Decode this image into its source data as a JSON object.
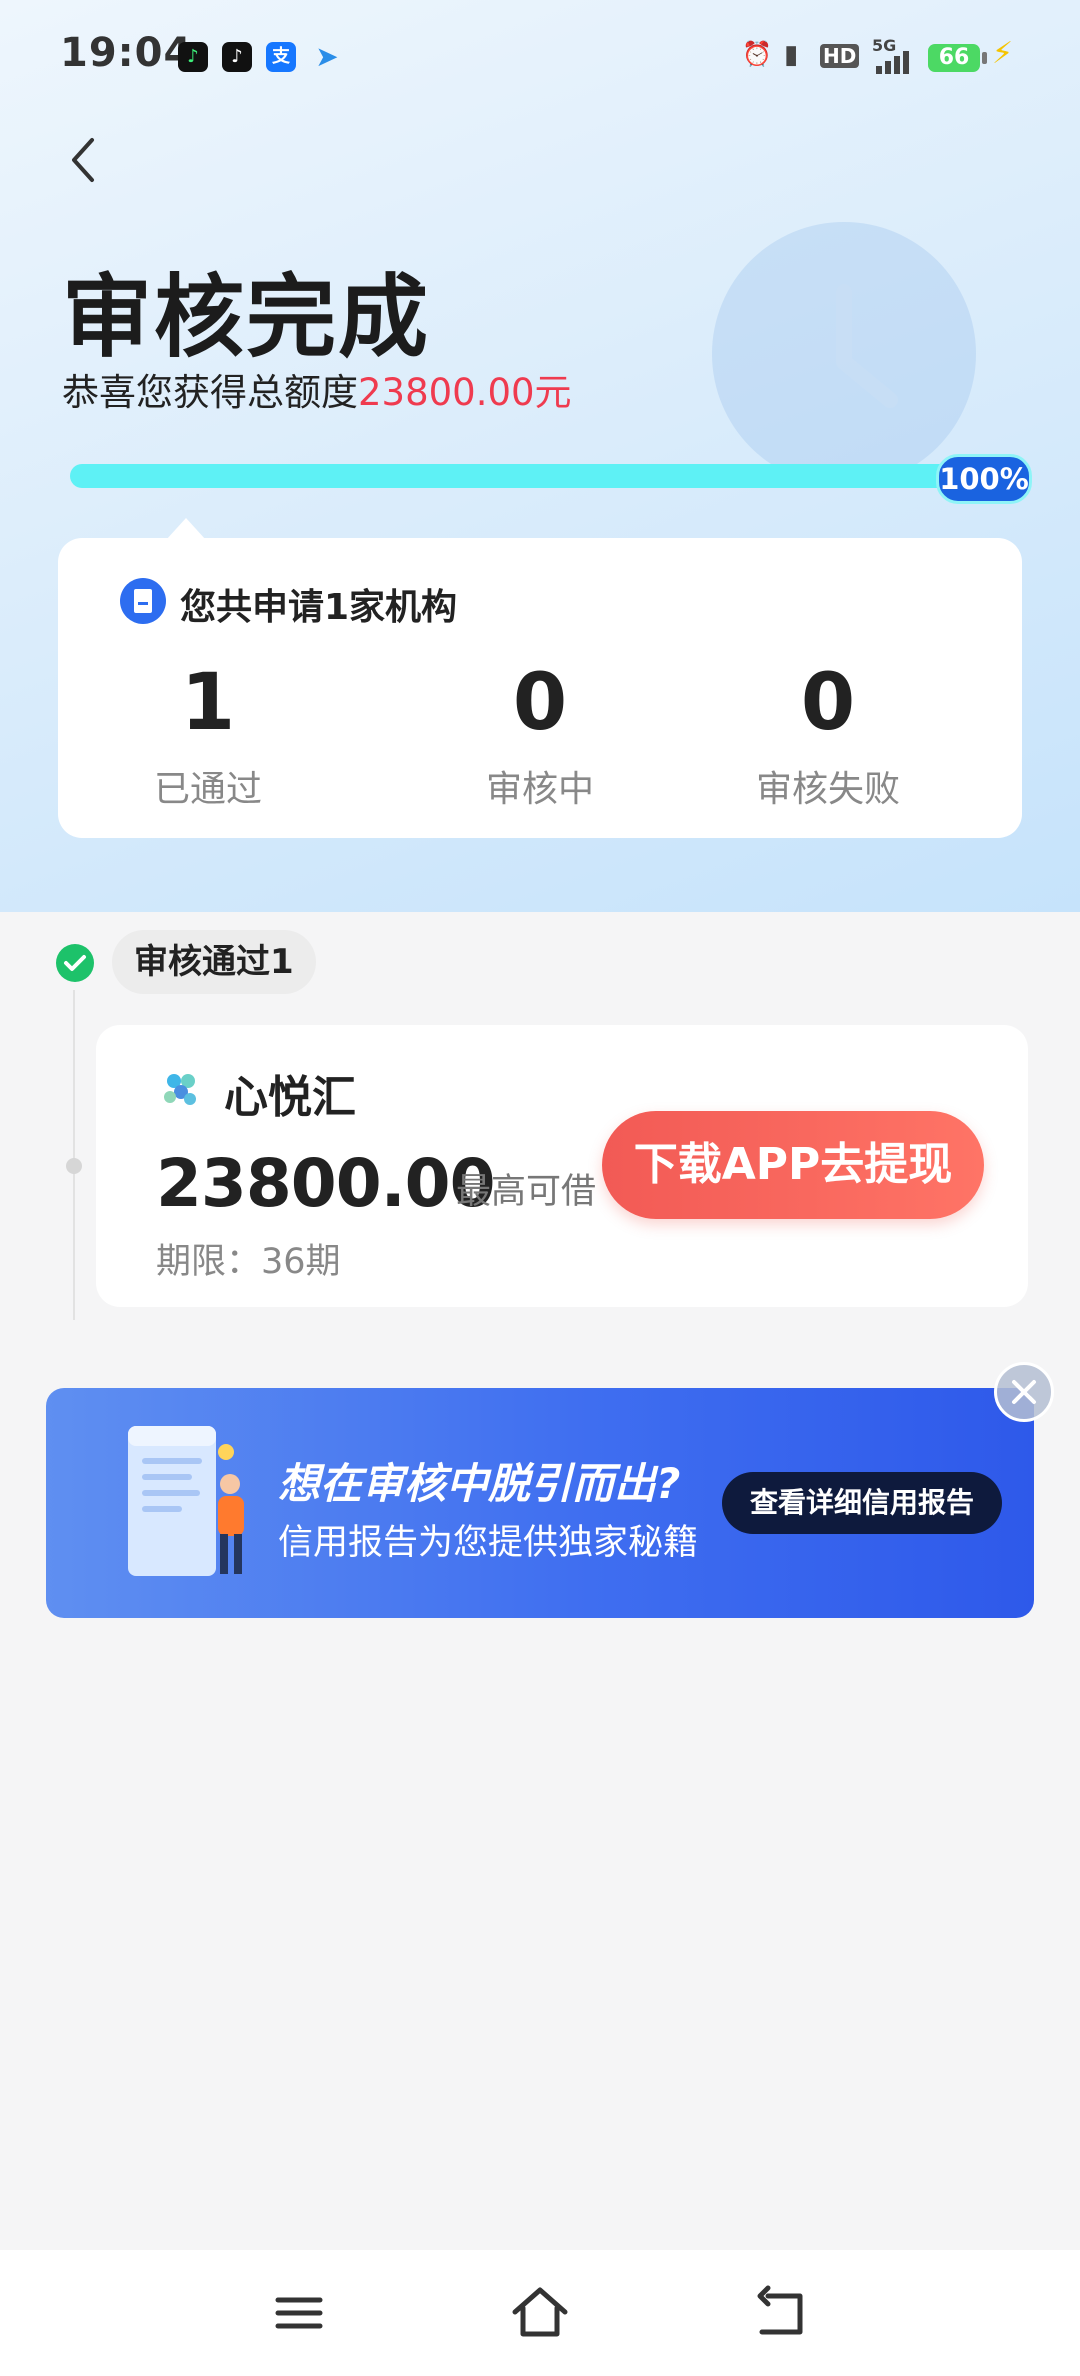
{
  "status_bar": {
    "time": "19:04",
    "app_icons": [
      "music-app-icon",
      "tiktok-icon",
      "alipay-icon",
      "send-icon"
    ],
    "indicators": [
      "alarm-icon",
      "vibrate-icon",
      "hd-icon",
      "signal-5g-icon"
    ],
    "network": "5G",
    "hd": "HD",
    "battery": "66"
  },
  "header": {
    "title": "审核完成",
    "subtitle_prefix": "恭喜您获得总额度",
    "subtitle_amount": "23800.00元",
    "progress_label": "100%",
    "progress_fraction": 1.0
  },
  "summary": {
    "title": "您共申请1家机构",
    "stats": [
      {
        "value": "1",
        "label": "已通过"
      },
      {
        "value": "0",
        "label": "审核中"
      },
      {
        "value": "0",
        "label": "审核失败"
      }
    ]
  },
  "section": {
    "badge": "审核通过1"
  },
  "lender": {
    "name": "心悦汇",
    "amount": "23800.00",
    "amount_note": "最高可借",
    "period": "期限：36期",
    "cta": "下载APP去提现"
  },
  "banner": {
    "title": "想在审核中脱引而出?",
    "subtitle": "信用报告为您提供独家秘籍",
    "button": "查看详细信用报告"
  },
  "colors": {
    "accent_red": "#ef3b4f",
    "cta": "#f25a55",
    "progress": "#5ef1f5",
    "banner_blue": "#3f6ef0",
    "success_green": "#1dc26a"
  }
}
